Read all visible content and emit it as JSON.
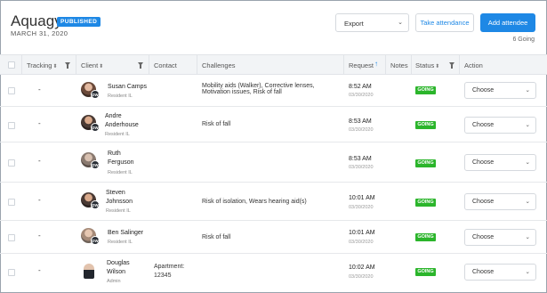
{
  "header": {
    "title": "Aquagym",
    "badge": "PUBLISHED",
    "date": "MARCH 31, 2020",
    "export_label": "Export",
    "take_attendance_label": "Take attendance",
    "add_attendee_label": "Add attendee",
    "going_count": "6 Going"
  },
  "table": {
    "columns": {
      "tracking": "Tracking",
      "client": "Client",
      "contact": "Contact",
      "challenges": "Challenges",
      "request": "Request",
      "notes": "Notes",
      "status": "Status",
      "action": "Action"
    },
    "rows": [
      {
        "tracking": "-",
        "name_line1": "Susan Camps",
        "name_line2": "",
        "role": "Resident IL",
        "initials": "DW",
        "contact_line1": "",
        "contact_line2": "",
        "challenges_line1": "Mobility aids (Walker), Corrective lenses,",
        "challenges_line2": "Motivation issues, Risk of fall",
        "time": "8:52 AM",
        "date": "03/30/2020",
        "status": "GOING",
        "action": "Choose"
      },
      {
        "tracking": "-",
        "name_line1": "Andre",
        "name_line2": "Anderhouse",
        "role": "Resident IL",
        "initials": "DW",
        "contact_line1": "",
        "contact_line2": "",
        "challenges_line1": "Risk of fall",
        "challenges_line2": "",
        "time": "8:53 AM",
        "date": "03/30/2020",
        "status": "GOING",
        "action": "Choose"
      },
      {
        "tracking": "-",
        "name_line1": "Ruth",
        "name_line2": "Ferguson",
        "role": "Resident IL",
        "initials": "DW",
        "contact_line1": "",
        "contact_line2": "",
        "challenges_line1": "",
        "challenges_line2": "",
        "time": "8:53 AM",
        "date": "03/30/2020",
        "status": "GOING",
        "action": "Choose"
      },
      {
        "tracking": "-",
        "name_line1": "Steven",
        "name_line2": "Johnsson",
        "role": "Resident IL",
        "initials": "DW",
        "contact_line1": "",
        "contact_line2": "",
        "challenges_line1": "Risk of isolation, Wears hearing aid(s)",
        "challenges_line2": "",
        "time": "10:01 AM",
        "date": "03/30/2020",
        "status": "GOING",
        "action": "Choose"
      },
      {
        "tracking": "-",
        "name_line1": "Ben Salinger",
        "name_line2": "",
        "role": "Resident IL",
        "initials": "DW",
        "contact_line1": "",
        "contact_line2": "",
        "challenges_line1": "Risk of fall",
        "challenges_line2": "",
        "time": "10:01 AM",
        "date": "03/30/2020",
        "status": "GOING",
        "action": "Choose"
      },
      {
        "tracking": "-",
        "name_line1": "Douglas",
        "name_line2": "Wilson",
        "role": "Admin",
        "initials": "",
        "contact_line1": "Apartment:",
        "contact_line2": "12345",
        "challenges_line1": "",
        "challenges_line2": "",
        "time": "10:02 AM",
        "date": "03/30/2020",
        "status": "GOING",
        "action": "Choose"
      }
    ]
  },
  "colors": {
    "accent": "#1e88e5",
    "going": "#2bb52b",
    "header_bg": "#f2f4f6"
  },
  "icons": [
    "filter-icon",
    "sort-icon",
    "sort-ascending-icon",
    "chevron-down-icon",
    "checkbox-icon",
    "avatar-icon"
  ]
}
